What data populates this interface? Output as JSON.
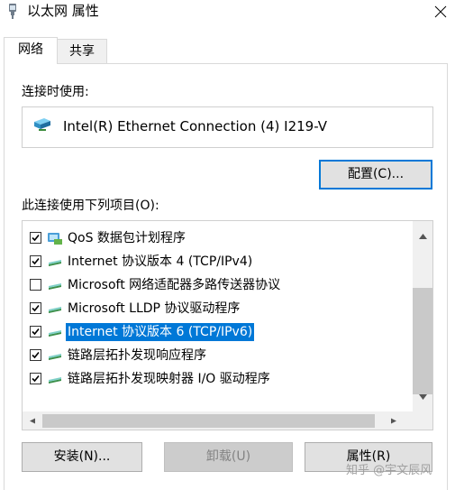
{
  "window": {
    "title": "以太网 属性",
    "close_icon": "close-icon",
    "title_icon": "network-adapter-icon"
  },
  "tabs": [
    {
      "label": "网络",
      "active": true
    },
    {
      "label": "共享",
      "active": false
    }
  ],
  "connect_using": {
    "label": "连接时使用:",
    "adapter_name": "Intel(R) Ethernet Connection (4) I219-V",
    "adapter_icon": "network-card-icon",
    "configure_label": "配置(C)..."
  },
  "items_section": {
    "label": "此连接使用下列项目(O):",
    "items": [
      {
        "label": "QoS 数据包计划程序",
        "checked": true,
        "selected": false
      },
      {
        "label": "Internet 协议版本 4 (TCP/IPv4)",
        "checked": true,
        "selected": false
      },
      {
        "label": "Microsoft 网络适配器多路传送器协议",
        "checked": false,
        "selected": false
      },
      {
        "label": "Microsoft LLDP 协议驱动程序",
        "checked": true,
        "selected": false
      },
      {
        "label": "Internet 协议版本 6 (TCP/IPv6)",
        "checked": true,
        "selected": true
      },
      {
        "label": "链路层拓扑发现响应程序",
        "checked": true,
        "selected": false
      },
      {
        "label": "链路层拓扑发现映射器 I/O 驱动程序",
        "checked": true,
        "selected": false
      }
    ]
  },
  "buttons": {
    "install": "安装(N)...",
    "uninstall": "卸载(U)",
    "properties": "属性(R)"
  },
  "watermark": "知乎 @宇文辰风",
  "colors": {
    "selection": "#0078d7",
    "button_face": "#e1e1e1",
    "disabled_text": "#838383"
  }
}
